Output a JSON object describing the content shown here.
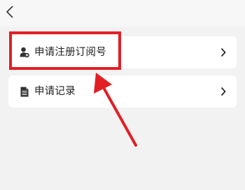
{
  "nav": {
    "back_icon": "chevron-left-icon"
  },
  "menu": {
    "items": [
      {
        "label": "申请注册订阅号",
        "icon": "user-add-icon",
        "chevron": "chevron-right-icon"
      },
      {
        "label": "申请记录",
        "icon": "document-icon",
        "chevron": "chevron-right-icon"
      }
    ]
  },
  "annotation": {
    "highlight_color": "#e31e24",
    "arrow_color": "#e31e24"
  }
}
